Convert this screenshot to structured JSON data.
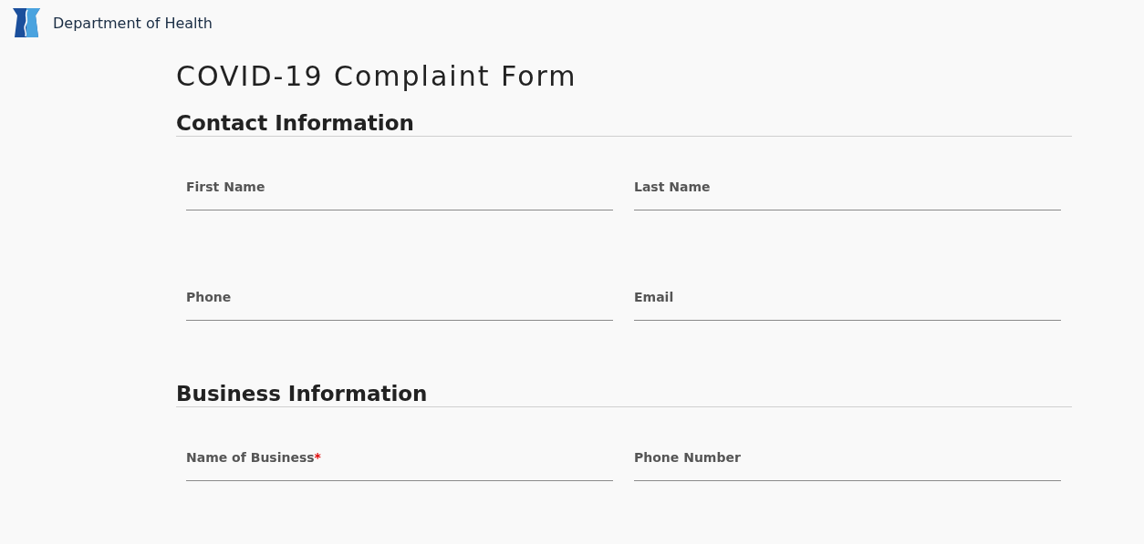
{
  "header": {
    "agency": "Department of Health"
  },
  "title": "COVID-19 Complaint Form",
  "sections": [
    {
      "heading": "Contact Information",
      "fields": [
        {
          "label": "First Name"
        },
        {
          "label": "Last Name"
        },
        {
          "label": "Phone"
        },
        {
          "label": "Email"
        }
      ]
    },
    {
      "heading": "Business Information",
      "fields": [
        {
          "label": "Name of Business",
          "required_mark": "*"
        },
        {
          "label": "Phone Number"
        }
      ]
    }
  ]
}
